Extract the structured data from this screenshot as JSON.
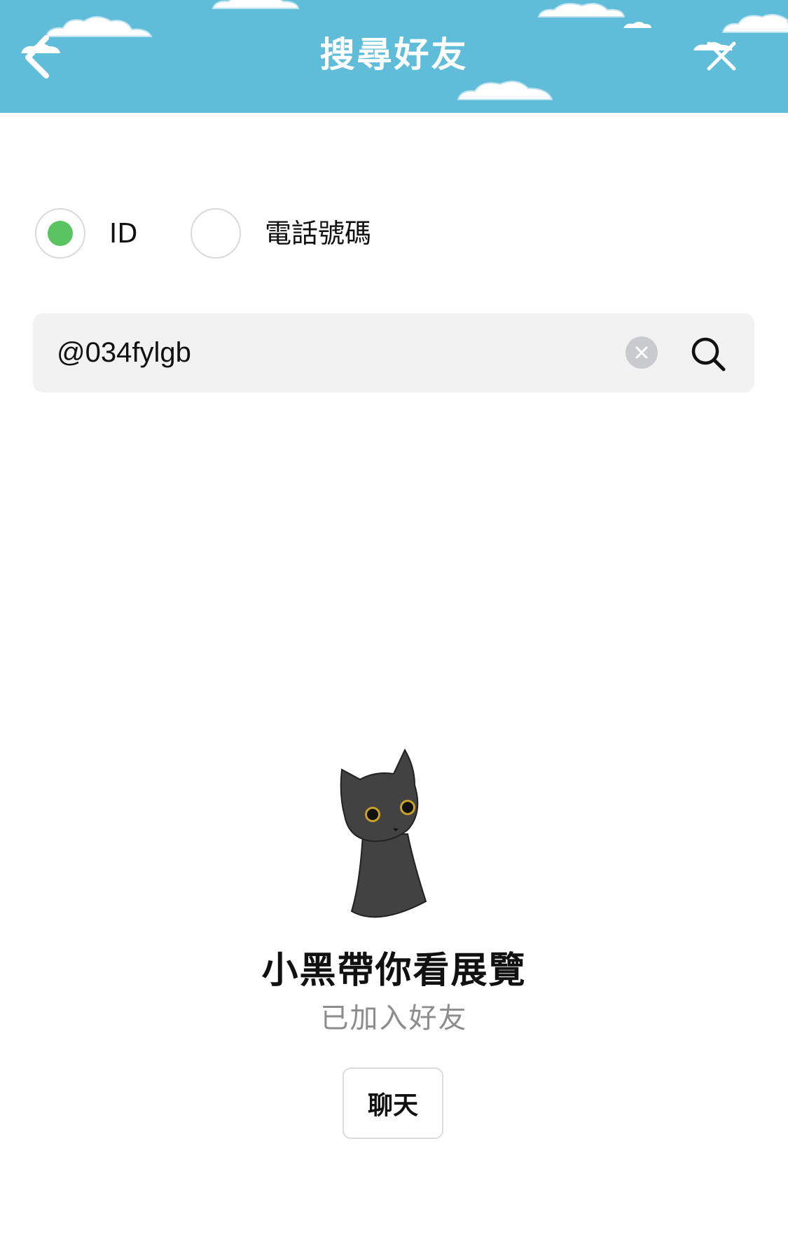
{
  "header": {
    "title": "搜尋好友",
    "back_icon": "chevron-left-icon",
    "close_icon": "close-icon",
    "background_color": "#5fbdd9"
  },
  "search_type": {
    "selected": "ID",
    "options": [
      {
        "label": "ID",
        "selected": true
      },
      {
        "label": "電話號碼",
        "selected": false
      }
    ],
    "selected_color": "#5ac463"
  },
  "search": {
    "value": "@034fylgb",
    "clear_icon": "clear-icon",
    "search_icon": "search-icon"
  },
  "result": {
    "avatar": "black-cat-avatar",
    "name": "小黑帶你看展覽",
    "status": "已加入好友",
    "chat_button_label": "聊天"
  }
}
